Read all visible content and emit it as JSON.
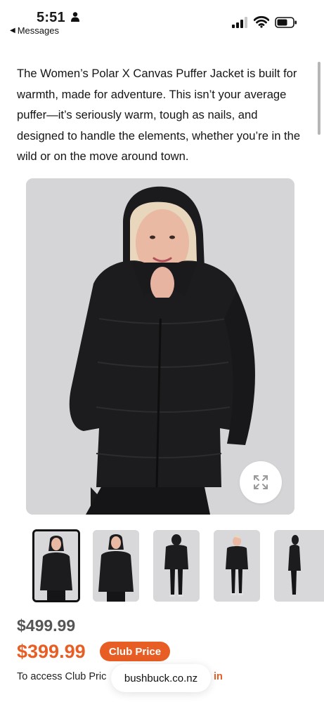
{
  "status_bar": {
    "time": "5:51",
    "back_label": "Messages"
  },
  "product": {
    "description": "The Women’s Polar X Canvas Puffer Jacket is built for warmth, made for adventure. This isn’t your average puffer—it’s seriously warm, tough as nails, and designed to handle the elements, whether you’re in the wild or on the move around town.",
    "old_price": "$499.99",
    "new_price": "$399.99",
    "club_badge": "Club Price",
    "club_info": "To access Club Pric",
    "signin_fragment": "in",
    "thumbnails": [
      {
        "label": "front-hood-up",
        "selected": true
      },
      {
        "label": "front-hand-chin",
        "selected": false
      },
      {
        "label": "full-length-front",
        "selected": false
      },
      {
        "label": "full-length-front-2",
        "selected": false
      },
      {
        "label": "side-view",
        "selected": false
      }
    ]
  },
  "browser": {
    "url": "bushbuck.co.nz"
  },
  "colors": {
    "accent": "#e85d24",
    "jacket": "#1b1b1d",
    "photo_bg": "#d5d5d7"
  }
}
